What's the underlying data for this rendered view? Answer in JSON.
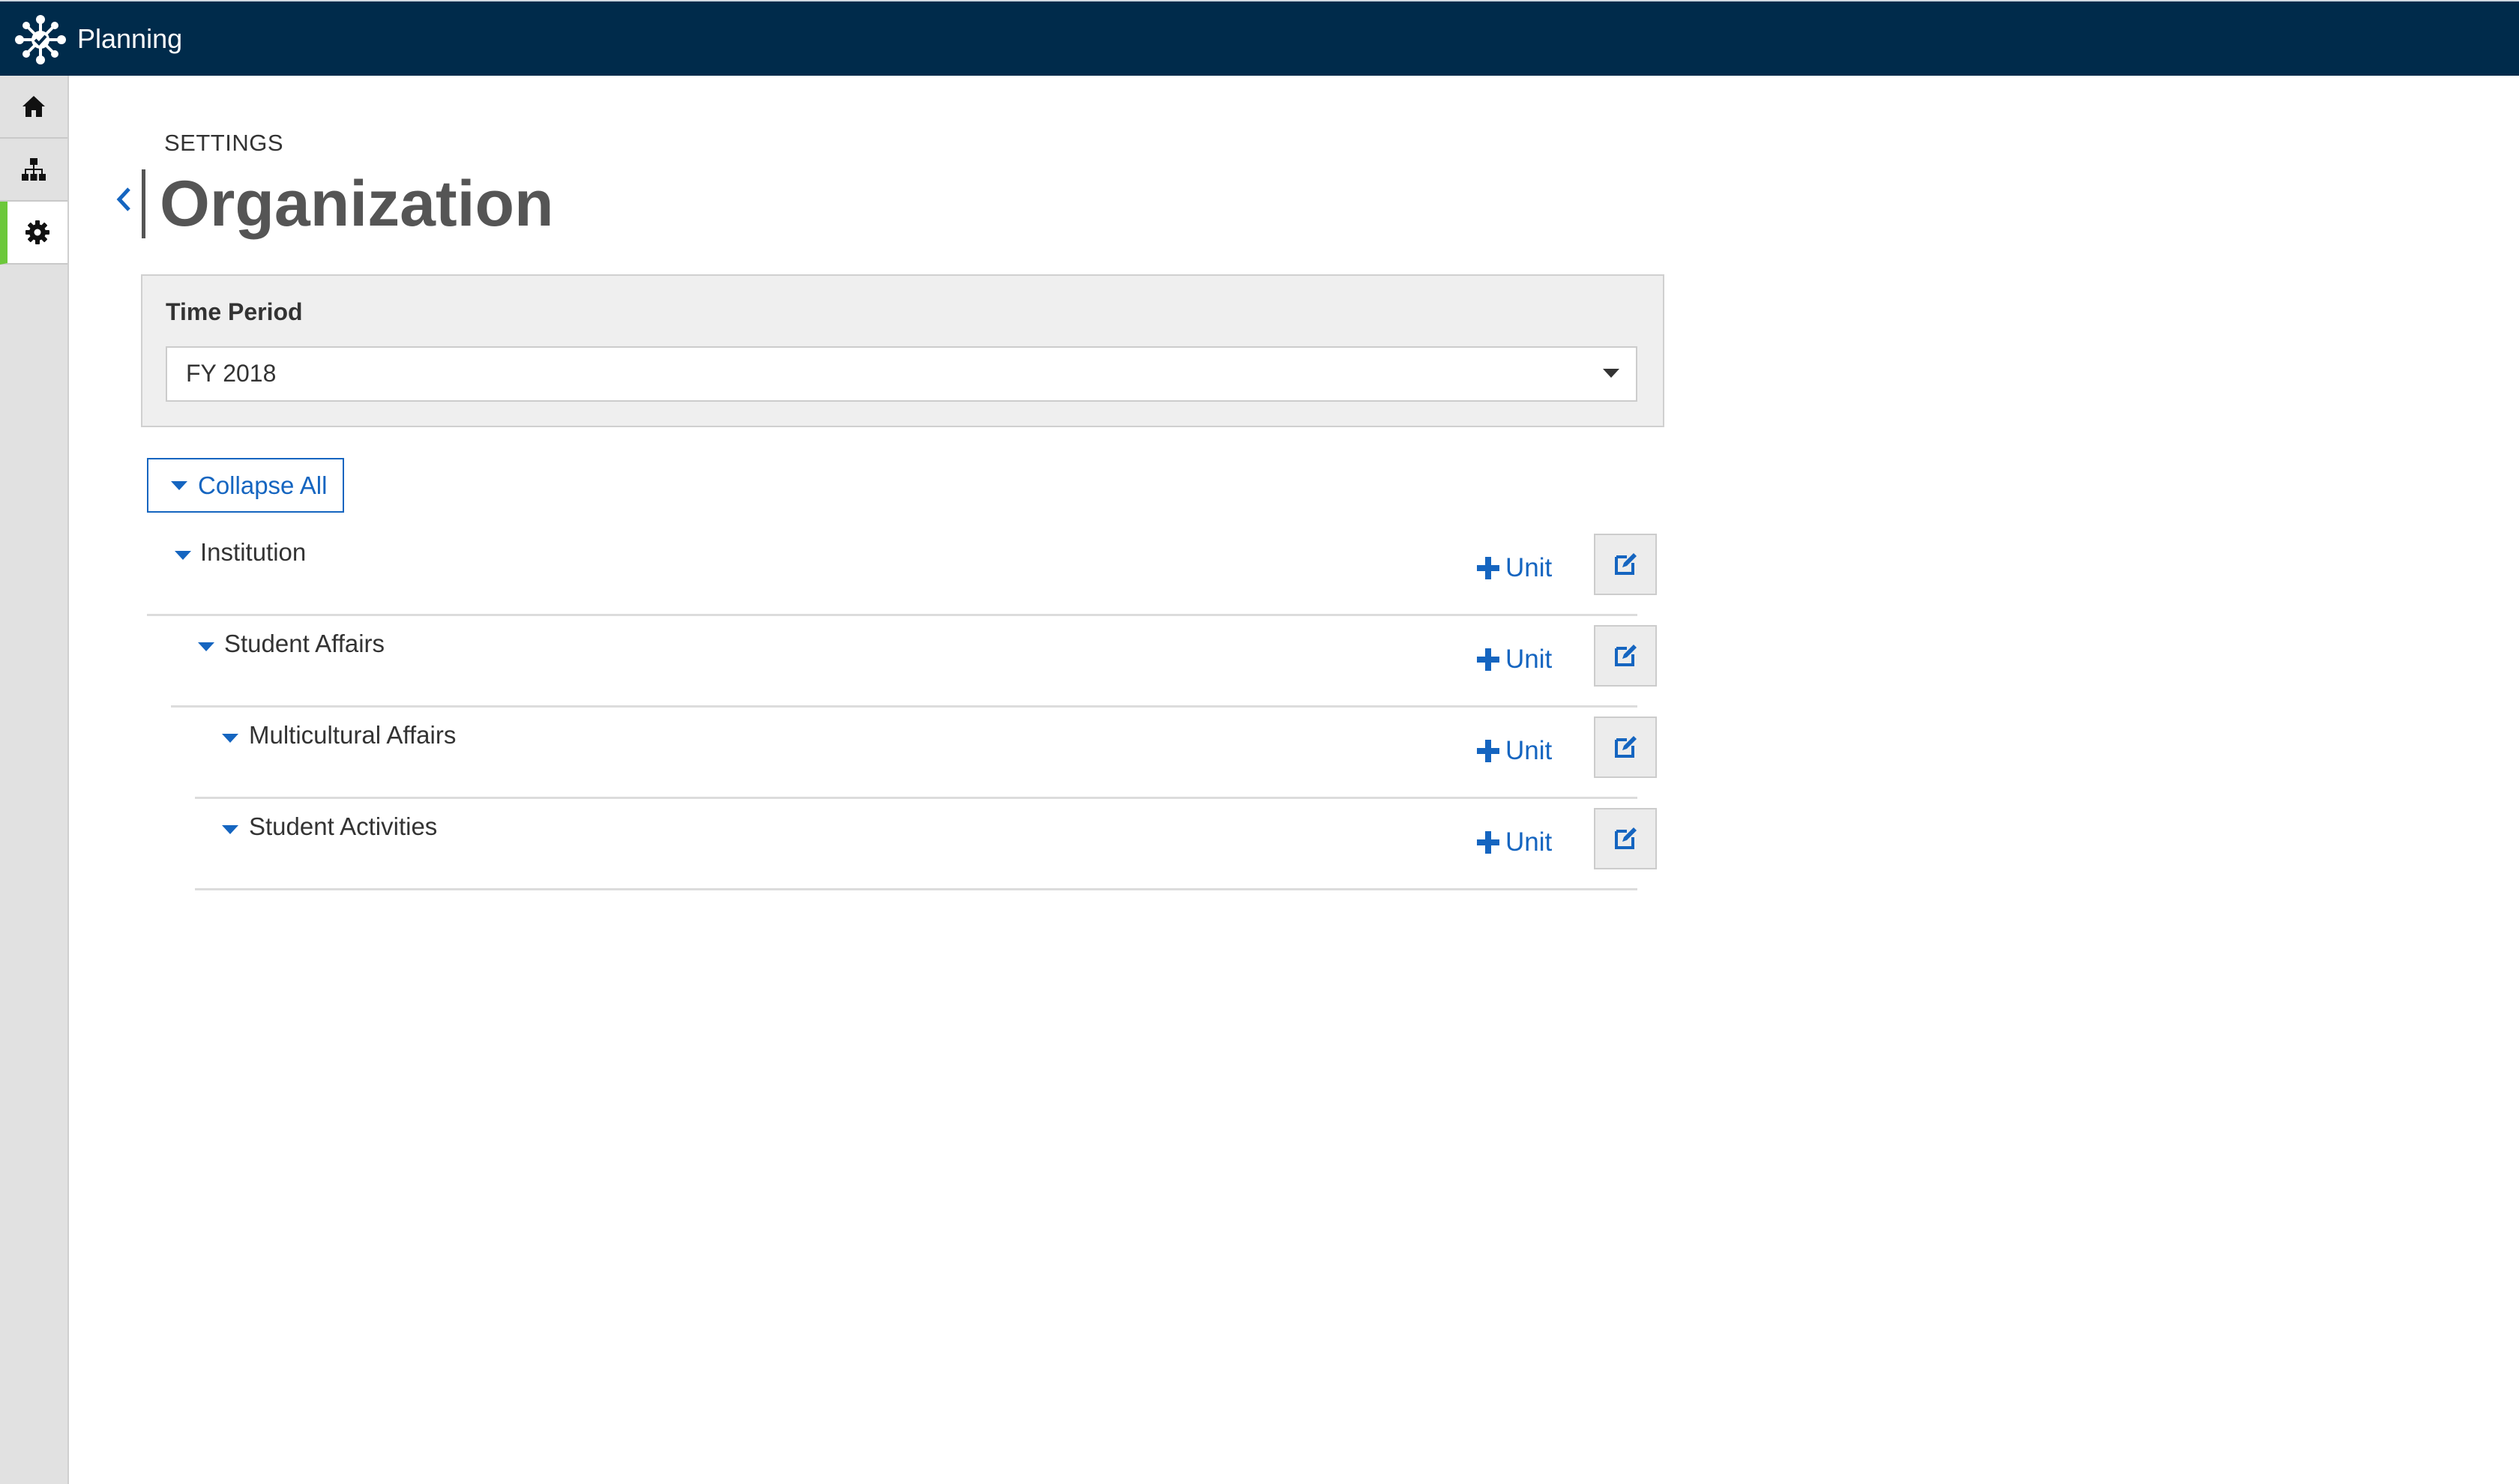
{
  "app": {
    "title": "Planning"
  },
  "sidebar": {
    "items": [
      {
        "icon": "home-icon",
        "active": false
      },
      {
        "icon": "org-chart-icon",
        "active": false
      },
      {
        "icon": "gear-icon",
        "active": true
      }
    ]
  },
  "header": {
    "eyebrow": "SETTINGS",
    "title": "Organization"
  },
  "time_period": {
    "label": "Time Period",
    "selected": "FY 2018"
  },
  "collapse_all_label": "Collapse All",
  "tree": {
    "add_unit_label": "Unit",
    "nodes": [
      {
        "name": "Institution"
      },
      {
        "name": "Student Affairs"
      },
      {
        "name": "Multicultural Affairs"
      },
      {
        "name": "Student Activities"
      }
    ]
  },
  "colors": {
    "topbar": "#002b4b",
    "accent": "#1565c0",
    "active_nav": "#6cc83a"
  }
}
